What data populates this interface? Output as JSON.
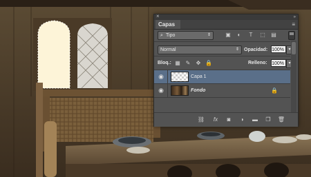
{
  "panel": {
    "tab_label": "Capas",
    "close_glyph": "×",
    "collapse_glyph": "»",
    "menu_glyph": "≡",
    "filter": {
      "search_glyph": "⌕",
      "label": "Tipo",
      "arrow": "⇕"
    },
    "filter_icons": [
      {
        "name": "image-filter-icon",
        "glyph": "▣"
      },
      {
        "name": "adjustment-filter-icon",
        "glyph": "◐"
      },
      {
        "name": "type-filter-icon",
        "glyph": "T"
      },
      {
        "name": "shape-filter-icon",
        "glyph": "⬚"
      },
      {
        "name": "smart-object-filter-icon",
        "glyph": "▤"
      }
    ],
    "blend_mode": "Normal",
    "blend_arrow": "⇕",
    "opacity_label": "Opacidad:",
    "opacity_value": "100%",
    "lock_label": "Bloq.:",
    "lock_icons": [
      {
        "name": "lock-transparency-icon",
        "glyph": "▦"
      },
      {
        "name": "lock-pixels-icon",
        "glyph": "✎"
      },
      {
        "name": "lock-position-icon",
        "glyph": "✥"
      },
      {
        "name": "lock-all-icon",
        "glyph": "🔒"
      }
    ],
    "fill_label": "Relleno:",
    "fill_value": "100%",
    "field_arrow": "▾",
    "layers": [
      {
        "name": "Capa 1",
        "eye": "◉",
        "selected": true
      },
      {
        "name": "Fondo",
        "eye": "◉",
        "selected": false,
        "lock": "🔒"
      }
    ],
    "bottom_icons": [
      {
        "name": "link-layers-icon",
        "glyph": "⛓"
      },
      {
        "name": "layer-style-icon",
        "glyph": "fx"
      },
      {
        "name": "layer-mask-icon",
        "glyph": "◙"
      },
      {
        "name": "adjustment-layer-icon",
        "glyph": "◑"
      },
      {
        "name": "new-group-icon",
        "glyph": "▬"
      },
      {
        "name": "new-layer-icon",
        "glyph": "❐"
      },
      {
        "name": "trash-icon",
        "glyph": "🗑"
      }
    ],
    "colors": {
      "panel_bg": "#535353",
      "selected_row": "#5a6f89",
      "text": "#e8e8e8"
    }
  }
}
